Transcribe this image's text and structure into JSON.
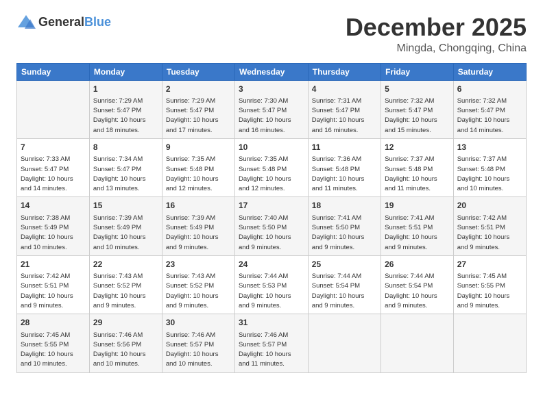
{
  "logo": {
    "general": "General",
    "blue": "Blue"
  },
  "header": {
    "month": "December 2025",
    "location": "Mingda, Chongqing, China"
  },
  "days_of_week": [
    "Sunday",
    "Monday",
    "Tuesday",
    "Wednesday",
    "Thursday",
    "Friday",
    "Saturday"
  ],
  "weeks": [
    [
      {
        "day": "",
        "info": ""
      },
      {
        "day": "1",
        "info": "Sunrise: 7:29 AM\nSunset: 5:47 PM\nDaylight: 10 hours\nand 18 minutes."
      },
      {
        "day": "2",
        "info": "Sunrise: 7:29 AM\nSunset: 5:47 PM\nDaylight: 10 hours\nand 17 minutes."
      },
      {
        "day": "3",
        "info": "Sunrise: 7:30 AM\nSunset: 5:47 PM\nDaylight: 10 hours\nand 16 minutes."
      },
      {
        "day": "4",
        "info": "Sunrise: 7:31 AM\nSunset: 5:47 PM\nDaylight: 10 hours\nand 16 minutes."
      },
      {
        "day": "5",
        "info": "Sunrise: 7:32 AM\nSunset: 5:47 PM\nDaylight: 10 hours\nand 15 minutes."
      },
      {
        "day": "6",
        "info": "Sunrise: 7:32 AM\nSunset: 5:47 PM\nDaylight: 10 hours\nand 14 minutes."
      }
    ],
    [
      {
        "day": "7",
        "info": "Sunrise: 7:33 AM\nSunset: 5:47 PM\nDaylight: 10 hours\nand 14 minutes."
      },
      {
        "day": "8",
        "info": "Sunrise: 7:34 AM\nSunset: 5:47 PM\nDaylight: 10 hours\nand 13 minutes."
      },
      {
        "day": "9",
        "info": "Sunrise: 7:35 AM\nSunset: 5:48 PM\nDaylight: 10 hours\nand 12 minutes."
      },
      {
        "day": "10",
        "info": "Sunrise: 7:35 AM\nSunset: 5:48 PM\nDaylight: 10 hours\nand 12 minutes."
      },
      {
        "day": "11",
        "info": "Sunrise: 7:36 AM\nSunset: 5:48 PM\nDaylight: 10 hours\nand 11 minutes."
      },
      {
        "day": "12",
        "info": "Sunrise: 7:37 AM\nSunset: 5:48 PM\nDaylight: 10 hours\nand 11 minutes."
      },
      {
        "day": "13",
        "info": "Sunrise: 7:37 AM\nSunset: 5:48 PM\nDaylight: 10 hours\nand 10 minutes."
      }
    ],
    [
      {
        "day": "14",
        "info": "Sunrise: 7:38 AM\nSunset: 5:49 PM\nDaylight: 10 hours\nand 10 minutes."
      },
      {
        "day": "15",
        "info": "Sunrise: 7:39 AM\nSunset: 5:49 PM\nDaylight: 10 hours\nand 10 minutes."
      },
      {
        "day": "16",
        "info": "Sunrise: 7:39 AM\nSunset: 5:49 PM\nDaylight: 10 hours\nand 9 minutes."
      },
      {
        "day": "17",
        "info": "Sunrise: 7:40 AM\nSunset: 5:50 PM\nDaylight: 10 hours\nand 9 minutes."
      },
      {
        "day": "18",
        "info": "Sunrise: 7:41 AM\nSunset: 5:50 PM\nDaylight: 10 hours\nand 9 minutes."
      },
      {
        "day": "19",
        "info": "Sunrise: 7:41 AM\nSunset: 5:51 PM\nDaylight: 10 hours\nand 9 minutes."
      },
      {
        "day": "20",
        "info": "Sunrise: 7:42 AM\nSunset: 5:51 PM\nDaylight: 10 hours\nand 9 minutes."
      }
    ],
    [
      {
        "day": "21",
        "info": "Sunrise: 7:42 AM\nSunset: 5:51 PM\nDaylight: 10 hours\nand 9 minutes."
      },
      {
        "day": "22",
        "info": "Sunrise: 7:43 AM\nSunset: 5:52 PM\nDaylight: 10 hours\nand 9 minutes."
      },
      {
        "day": "23",
        "info": "Sunrise: 7:43 AM\nSunset: 5:52 PM\nDaylight: 10 hours\nand 9 minutes."
      },
      {
        "day": "24",
        "info": "Sunrise: 7:44 AM\nSunset: 5:53 PM\nDaylight: 10 hours\nand 9 minutes."
      },
      {
        "day": "25",
        "info": "Sunrise: 7:44 AM\nSunset: 5:54 PM\nDaylight: 10 hours\nand 9 minutes."
      },
      {
        "day": "26",
        "info": "Sunrise: 7:44 AM\nSunset: 5:54 PM\nDaylight: 10 hours\nand 9 minutes."
      },
      {
        "day": "27",
        "info": "Sunrise: 7:45 AM\nSunset: 5:55 PM\nDaylight: 10 hours\nand 9 minutes."
      }
    ],
    [
      {
        "day": "28",
        "info": "Sunrise: 7:45 AM\nSunset: 5:55 PM\nDaylight: 10 hours\nand 10 minutes."
      },
      {
        "day": "29",
        "info": "Sunrise: 7:46 AM\nSunset: 5:56 PM\nDaylight: 10 hours\nand 10 minutes."
      },
      {
        "day": "30",
        "info": "Sunrise: 7:46 AM\nSunset: 5:57 PM\nDaylight: 10 hours\nand 10 minutes."
      },
      {
        "day": "31",
        "info": "Sunrise: 7:46 AM\nSunset: 5:57 PM\nDaylight: 10 hours\nand 11 minutes."
      },
      {
        "day": "",
        "info": ""
      },
      {
        "day": "",
        "info": ""
      },
      {
        "day": "",
        "info": ""
      }
    ]
  ]
}
